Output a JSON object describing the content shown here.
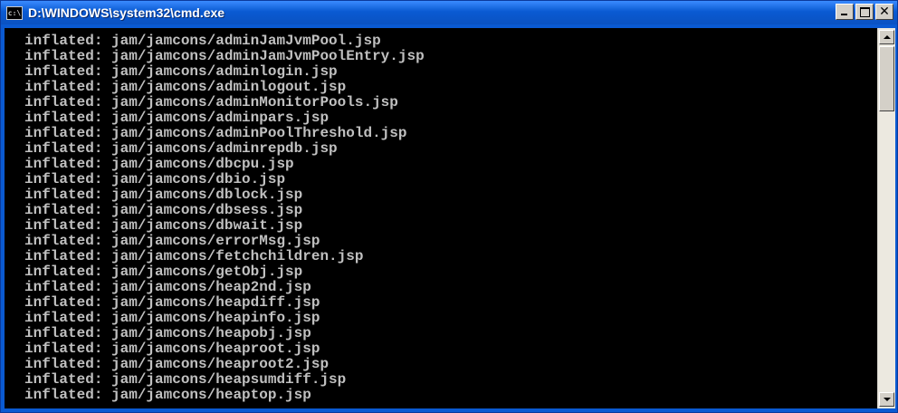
{
  "window": {
    "title": "D:\\WINDOWS\\system32\\cmd.exe",
    "icon": "cmd-icon",
    "controls": {
      "minimize": "minimize-icon",
      "maximize": "maximize-icon",
      "close": "✕"
    }
  },
  "console": {
    "lines": [
      "inflated: jam/jamcons/adminJamJvmPool.jsp",
      "inflated: jam/jamcons/adminJamJvmPoolEntry.jsp",
      "inflated: jam/jamcons/adminlogin.jsp",
      "inflated: jam/jamcons/adminlogout.jsp",
      "inflated: jam/jamcons/adminMonitorPools.jsp",
      "inflated: jam/jamcons/adminpars.jsp",
      "inflated: jam/jamcons/adminPoolThreshold.jsp",
      "inflated: jam/jamcons/adminrepdb.jsp",
      "inflated: jam/jamcons/dbcpu.jsp",
      "inflated: jam/jamcons/dbio.jsp",
      "inflated: jam/jamcons/dblock.jsp",
      "inflated: jam/jamcons/dbsess.jsp",
      "inflated: jam/jamcons/dbwait.jsp",
      "inflated: jam/jamcons/errorMsg.jsp",
      "inflated: jam/jamcons/fetchchildren.jsp",
      "inflated: jam/jamcons/getObj.jsp",
      "inflated: jam/jamcons/heap2nd.jsp",
      "inflated: jam/jamcons/heapdiff.jsp",
      "inflated: jam/jamcons/heapinfo.jsp",
      "inflated: jam/jamcons/heapobj.jsp",
      "inflated: jam/jamcons/heaproot.jsp",
      "inflated: jam/jamcons/heaproot2.jsp",
      "inflated: jam/jamcons/heapsumdiff.jsp",
      "inflated: jam/jamcons/heaptop.jsp"
    ]
  },
  "scrollbar": {
    "up": "scroll-up-icon",
    "down": "scroll-down-icon"
  },
  "colors": {
    "titlebar": "#0a5ad2",
    "console_bg": "#000000",
    "console_text": "#c0c0c0"
  }
}
